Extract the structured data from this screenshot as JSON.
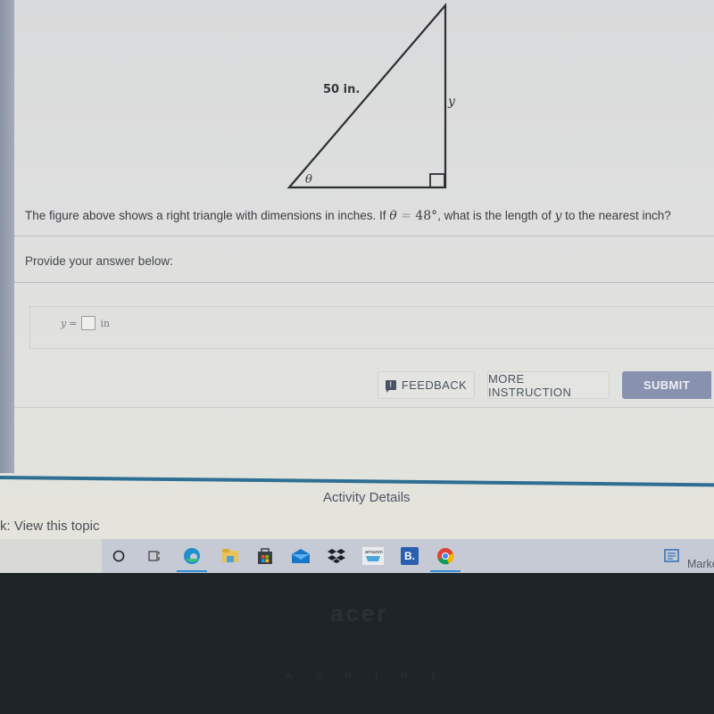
{
  "figure": {
    "hypotenuse_label": "50 in.",
    "opposite_label": "y",
    "angle_label": "θ"
  },
  "question": {
    "prefix": "The figure above shows a right triangle with dimensions in inches. If ",
    "theta": "θ",
    "equals": " = ",
    "angle_value": "48°",
    "middle": ", what is the length of ",
    "y_var": "y",
    "suffix": " to the nearest inch?"
  },
  "answer": {
    "prompt": "Provide your answer below:",
    "var_label": "y",
    "equals": "=",
    "value": "",
    "unit": "in"
  },
  "buttons": {
    "feedback": "FEEDBACK",
    "more_instruction": "MORE INSTRUCTION",
    "submit": "SUBMIT"
  },
  "footer": {
    "activity_details": "Activity Details",
    "topic_link": "k: View this topic"
  },
  "taskbar": {
    "apps": [
      {
        "name": "search",
        "icon": "search-circle-icon"
      },
      {
        "name": "task-view",
        "icon": "task-view-icon"
      },
      {
        "name": "edge",
        "icon": "edge-icon",
        "active": true
      },
      {
        "name": "file-explorer",
        "icon": "folder-icon"
      },
      {
        "name": "microsoft-store",
        "icon": "store-icon"
      },
      {
        "name": "mail",
        "icon": "mail-icon"
      },
      {
        "name": "dropbox",
        "icon": "dropbox-icon"
      },
      {
        "name": "amazon",
        "icon": "amazon-icon",
        "label": "amazon"
      },
      {
        "name": "booking",
        "icon": "booking-icon",
        "label": "B."
      },
      {
        "name": "chrome",
        "icon": "chrome-icon",
        "active": true
      }
    ],
    "right_label": "Marke"
  },
  "bezel": {
    "logo": "acer",
    "brand": "ASPIRE"
  },
  "colors": {
    "accent_rule": "#2e6f93",
    "submit_bg": "#8891ad",
    "text": "#3a3d44"
  }
}
